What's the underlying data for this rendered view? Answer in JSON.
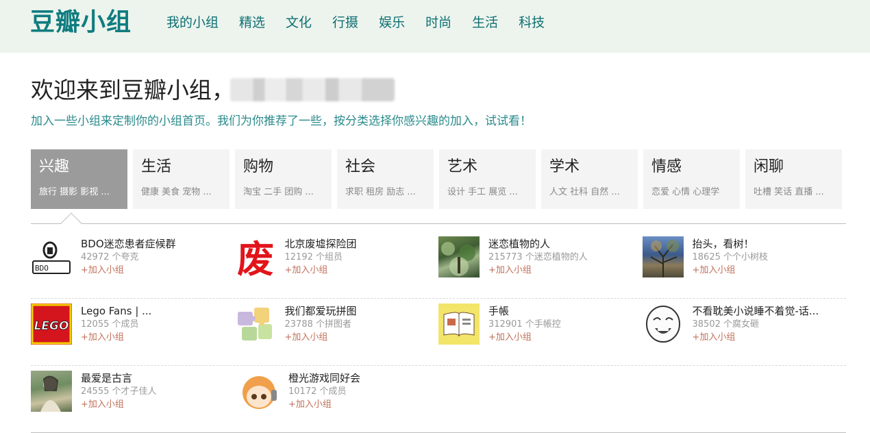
{
  "header": {
    "logo": "豆瓣小组",
    "nav": [
      "我的小组",
      "精选",
      "文化",
      "行摄",
      "娱乐",
      "时尚",
      "生活",
      "科技"
    ]
  },
  "welcome": {
    "title": "欢迎来到豆瓣小组，",
    "subtitle": "加入一些小组来定制你的小组首页。我们为你推荐了一些，按分类选择你感兴趣的加入，试试看！"
  },
  "categories": [
    {
      "title": "兴趣",
      "sub": "旅行 摄影 影视 ..."
    },
    {
      "title": "生活",
      "sub": "健康 美食 宠物 ..."
    },
    {
      "title": "购物",
      "sub": "淘宝 二手 团购 ..."
    },
    {
      "title": "社会",
      "sub": "求职 租房 励志 ..."
    },
    {
      "title": "艺术",
      "sub": "设计 手工 展览 ..."
    },
    {
      "title": "学术",
      "sub": "人文 社科 自然 ..."
    },
    {
      "title": "情感",
      "sub": "恋爱 心情 心理学"
    },
    {
      "title": "闲聊",
      "sub": "吐槽 笑话 直播 ..."
    }
  ],
  "groups": [
    {
      "name": "BDO迷恋患者症候群",
      "count": "42972 个夸克",
      "join": "+加入小组"
    },
    {
      "name": "北京废墟探险团",
      "count": "12192 个组员",
      "join": "+加入小组"
    },
    {
      "name": "迷恋植物的人",
      "count": "215773 个迷恋植物的人",
      "join": "+加入小组"
    },
    {
      "name": "抬头，看树！",
      "count": "18625 个个小树枝",
      "join": "+加入小组"
    },
    {
      "name": "Lego Fans | ...",
      "count": "12055 个成员",
      "join": "+加入小组"
    },
    {
      "name": "我们都爱玩拼图",
      "count": "23788 个拼图者",
      "join": "+加入小组"
    },
    {
      "name": "手帳",
      "count": "312901 个手帳控",
      "join": "+加入小组"
    },
    {
      "name": "不看耽美小说睡不着觉-话...",
      "count": "38502 个腐女砸",
      "join": "+加入小组"
    },
    {
      "name": "最爱是古言",
      "count": "24555 个才子佳人",
      "join": "+加入小组"
    },
    {
      "name": "橙光游戏同好会",
      "count": "10172 个成员",
      "join": "+加入小组"
    }
  ],
  "thumb_text": {
    "bdo": "BDO",
    "fei": "废",
    "lego": "LEGO"
  },
  "colors": {
    "brand": "#0f7c80",
    "nav_bg": "#edf4ed",
    "join": "#c0705a",
    "active_tab": "#9b9b9b"
  }
}
